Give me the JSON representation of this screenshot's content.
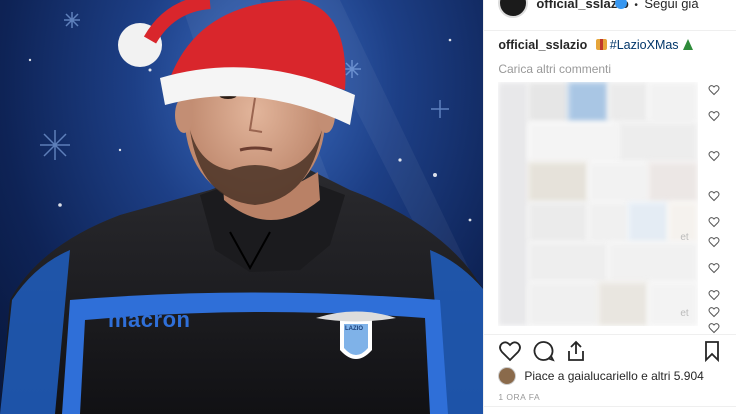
{
  "header": {
    "username": "official_sslazio",
    "separator": "•",
    "follow_label": "Segui già"
  },
  "caption": {
    "username": "official_sslazio",
    "hashtag": "#LazioXMas",
    "gift_emoji": "gift-icon",
    "tree_emoji": "christmas-tree-icon"
  },
  "load_more_label": "Carica altri commenti",
  "stray_text": [
    "et",
    "et"
  ],
  "likes": {
    "text": "Piace a gaialucariello e altri 5.904"
  },
  "time_label": "1 ORA FA",
  "media": {
    "jersey_brand": "macron",
    "crest_text": "LAZIO"
  },
  "colors": {
    "accent_link": "#003569",
    "verified": "#3897f0",
    "jersey": "#1a1a1a",
    "jersey_stripe": "#2f6fd8",
    "santa_hat": "#d9262c"
  }
}
